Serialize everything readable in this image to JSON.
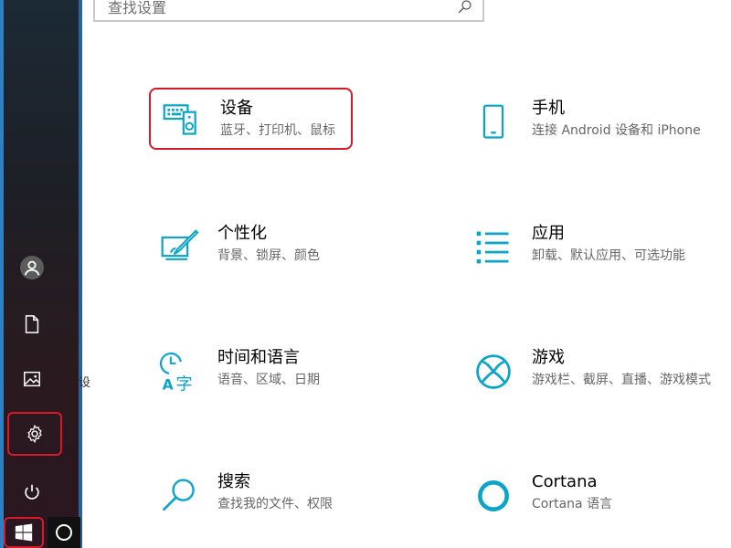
{
  "search": {
    "placeholder": "查找设置"
  },
  "start_rail": {
    "items": [
      {
        "name": "user",
        "icon": "user-icon"
      },
      {
        "name": "documents",
        "icon": "document-icon"
      },
      {
        "name": "pictures",
        "icon": "picture-icon"
      },
      {
        "name": "settings",
        "icon": "gear-icon",
        "highlighted": true
      },
      {
        "name": "power",
        "icon": "power-icon"
      }
    ],
    "stray_char": "设"
  },
  "taskbar": {
    "start_icon": "windows-logo-icon",
    "cortana_icon": "cortana-ring-icon"
  },
  "categories": [
    {
      "title": "设备",
      "desc": "蓝牙、打印机、鼠标",
      "icon": "keyboard-speaker-icon",
      "highlighted": true
    },
    {
      "title": "手机",
      "desc": "连接 Android 设备和 iPhone",
      "icon": "phone-icon"
    },
    {
      "title": "个性化",
      "desc": "背景、锁屏、颜色",
      "icon": "paint-brush-icon"
    },
    {
      "title": "应用",
      "desc": "卸载、默认应用、可选功能",
      "icon": "list-icon"
    },
    {
      "title": "时间和语言",
      "desc": "语音、区域、日期",
      "icon": "clock-language-icon"
    },
    {
      "title": "游戏",
      "desc": "游戏栏、截屏、直播、游戏模式",
      "icon": "xbox-icon"
    },
    {
      "title": "搜索",
      "desc": "查找我的文件、权限",
      "icon": "search-icon"
    },
    {
      "title": "Cortana",
      "desc": "Cortana 语言",
      "icon": "cortana-icon"
    }
  ],
  "colors": {
    "accent": "#0ba5c9",
    "highlight": "#d7192a",
    "rail": "#1e1f26"
  }
}
